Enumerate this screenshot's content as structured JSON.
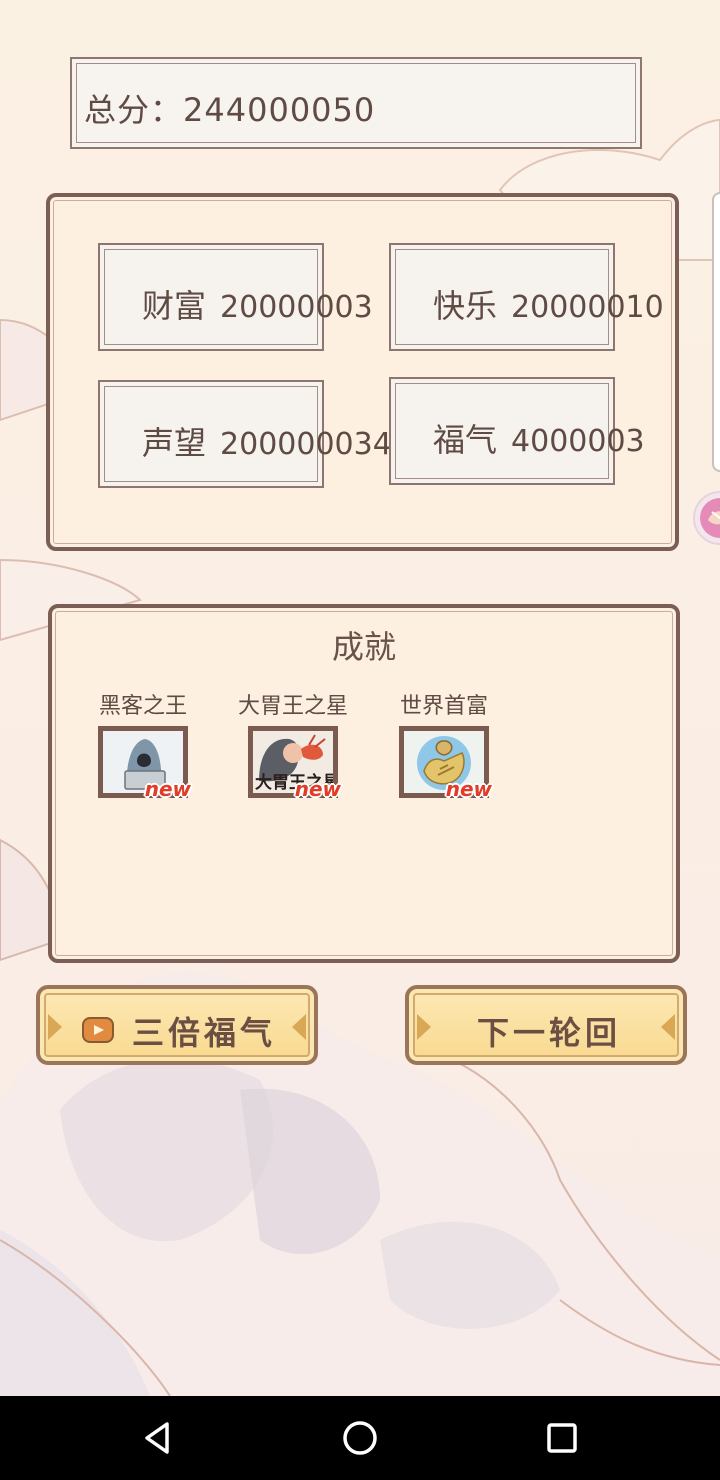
{
  "score": {
    "label": "总分：",
    "value": "244000050"
  },
  "stats": [
    {
      "label": "财富",
      "value": "20000003"
    },
    {
      "label": "快乐",
      "value": "20000010"
    },
    {
      "label": "声望",
      "value": "200000034"
    },
    {
      "label": "福气",
      "value": "4000003"
    }
  ],
  "achievements": {
    "title": "成就",
    "items": [
      {
        "name": "黑客之王",
        "badge": "new",
        "icon": "hacker-icon"
      },
      {
        "name": "大胃王之星",
        "badge": "new",
        "icon": "big-eater-icon",
        "art_text": "大胃王之星"
      },
      {
        "name": "世界首富",
        "badge": "new",
        "icon": "money-bag-icon"
      }
    ]
  },
  "buttons": {
    "triple": "三倍福气",
    "next": "下一轮回"
  },
  "colors": {
    "frame": "#7b5f56",
    "panel": "#fdf0e1",
    "button": "#f8d98f",
    "badge": "#e23b26"
  }
}
